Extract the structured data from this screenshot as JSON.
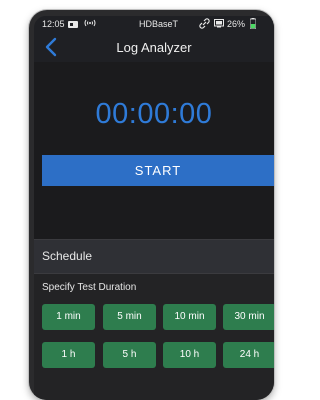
{
  "status_bar": {
    "time": "12:05",
    "network_name": "HDBaseT",
    "battery": "26%",
    "icons": [
      "card-icon",
      "wireless-icon",
      "link-icon",
      "screen-icon",
      "battery-icon"
    ]
  },
  "app_bar": {
    "title": "Log Analyzer",
    "back_icon": "chevron-left-icon"
  },
  "timer": {
    "value": "00:00:00",
    "color": "#2f7bd8"
  },
  "start_button": {
    "label": "START",
    "color": "#2d6fc6"
  },
  "schedule": {
    "header": "Schedule",
    "duration_label": "Specify Test Duration",
    "chip_color": "#2e7d4e",
    "durations_row1": [
      "1 min",
      "5 min",
      "10 min",
      "30 min"
    ],
    "durations_row2": [
      "1 h",
      "5 h",
      "10 h",
      "24 h"
    ]
  }
}
